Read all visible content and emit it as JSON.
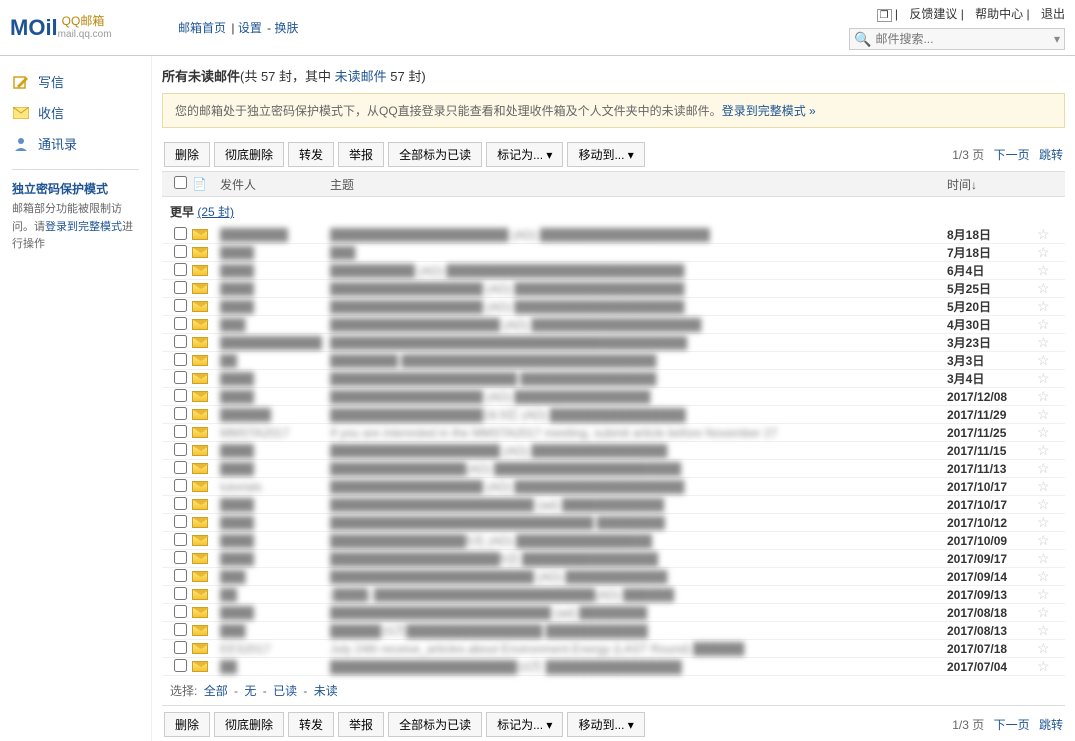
{
  "header": {
    "logo_main": "MOil",
    "logo_qq": "QQ邮箱",
    "logo_sub": "mail.qq.com",
    "nav_home": "邮箱首页",
    "nav_settings": "设置",
    "nav_skin": "换肤",
    "link_feedback": "反馈建议",
    "link_help": "帮助中心",
    "link_logout": "退出",
    "search_placeholder": "邮件搜索..."
  },
  "sidebar": {
    "compose": "写信",
    "receive": "收信",
    "contacts": "通讯录",
    "protect_title": "独立密码保护模式",
    "protect_desc1": "邮箱部分功能被限制访问。请",
    "protect_link": "登录到完整模式",
    "protect_desc2": "进行操作"
  },
  "main": {
    "title_prefix": "所有未读邮件",
    "title_count": "(共 57 封，其中 ",
    "title_unread": "未读邮件",
    "title_suffix": " 57 封)",
    "notice_text": "您的邮箱处于独立密码保护模式下，从QQ直接登录只能查看和处理收件箱及个人文件夹中的未读邮件。",
    "notice_link": "登录到完整模式 »"
  },
  "toolbar": {
    "delete": "删除",
    "delete_all": "彻底删除",
    "forward": "转发",
    "report": "举报",
    "mark_read": "全部标为已读",
    "mark_as": "标记为...",
    "move_to": "移动到..."
  },
  "pager": {
    "page": "1/3 页",
    "next": "下一页",
    "jump": "跳转"
  },
  "columns": {
    "sender": "发件人",
    "subject": "主题",
    "time": "时间↓"
  },
  "group": {
    "label": "更早",
    "count": "(25 封)"
  },
  "select": {
    "label": "选择:",
    "all": "全部",
    "none": "无",
    "read": "已读",
    "unread": "未读"
  },
  "emails": [
    {
      "sender": "████████",
      "subject": "█████████████████████ (AD)  ████████████████████",
      "time": "8月18日"
    },
    {
      "sender": "████",
      "subject": "███",
      "time": "7月18日"
    },
    {
      "sender": "████",
      "subject": "██████████ (AD)  ████████████████████████████",
      "time": "6月4日"
    },
    {
      "sender": "████",
      "subject": "██████████████████ (AD)  ████████████████████",
      "time": "5月25日"
    },
    {
      "sender": "████",
      "subject": "██████████████████ (AD)  ████████████████████",
      "time": "5月20日"
    },
    {
      "sender": "███",
      "subject": "████████████████████ (AD)  ████████████████████",
      "time": "4月30日"
    },
    {
      "sender": "████████████",
      "subject": "██████████████████████████████████████████",
      "time": "3月23日"
    },
    {
      "sender": "██",
      "subject": "████████  ██████████████████████████████",
      "time": "3月3日"
    },
    {
      "sender": "████",
      "subject": "██████████████████████  ████████████████",
      "time": "3月4日"
    },
    {
      "sender": "████",
      "subject": "██████████████████ (AD)  ████████████████",
      "time": "2017/12/08"
    },
    {
      "sender": "██████",
      "subject": "██████████████████18.5亿 (AD)  ████████████████",
      "time": "2017/11/29"
    },
    {
      "sender": "MMSTA2017",
      "subject": "If you are interested in the MMSTA2017 meeting, submit article before November 27",
      "time": "2017/11/25"
    },
    {
      "sender": "████",
      "subject": "████████████████████ (AD)  ████████████████",
      "time": "2017/11/15"
    },
    {
      "sender": "████",
      "subject": "████████████████(AD)  ██████████████████████",
      "time": "2017/11/13"
    },
    {
      "sender": "tutorials",
      "subject": "██████████████████ (AD)  ████████████████████",
      "time": "2017/10/17"
    },
    {
      "sender": "████",
      "subject": "████████████████████████ (ad)  ████████████",
      "time": "2017/10/17"
    },
    {
      "sender": "████",
      "subject": "███████████████████████████████  ████████",
      "time": "2017/10/12"
    },
    {
      "sender": "████",
      "subject": "████████████████5元 (AD)  ████████████████",
      "time": "2017/10/09"
    },
    {
      "sender": "████",
      "subject": "████████████████████5日  ████████████████",
      "time": "2017/09/17"
    },
    {
      "sender": "███",
      "subject": "████████████████████████ (AD)  ████████████",
      "time": "2017/09/14"
    },
    {
      "sender": "██",
      "subject": "[████] ██████████████████████████(AD)  ██████",
      "time": "2017/09/13"
    },
    {
      "sender": "████",
      "subject": "██████████████████████████ (ad)  ████████",
      "time": "2017/08/18"
    },
    {
      "sender": "███",
      "subject": "██████15万████████████████  ████████████",
      "time": "2017/08/13"
    },
    {
      "sender": "EES2017",
      "subject": "July 24th receive_articles.about Environment.Energy (LAST Round)  ██████",
      "time": "2017/07/18"
    },
    {
      "sender": "██",
      "subject": "██████████████████████10万  ████████████████",
      "time": "2017/07/04"
    }
  ]
}
